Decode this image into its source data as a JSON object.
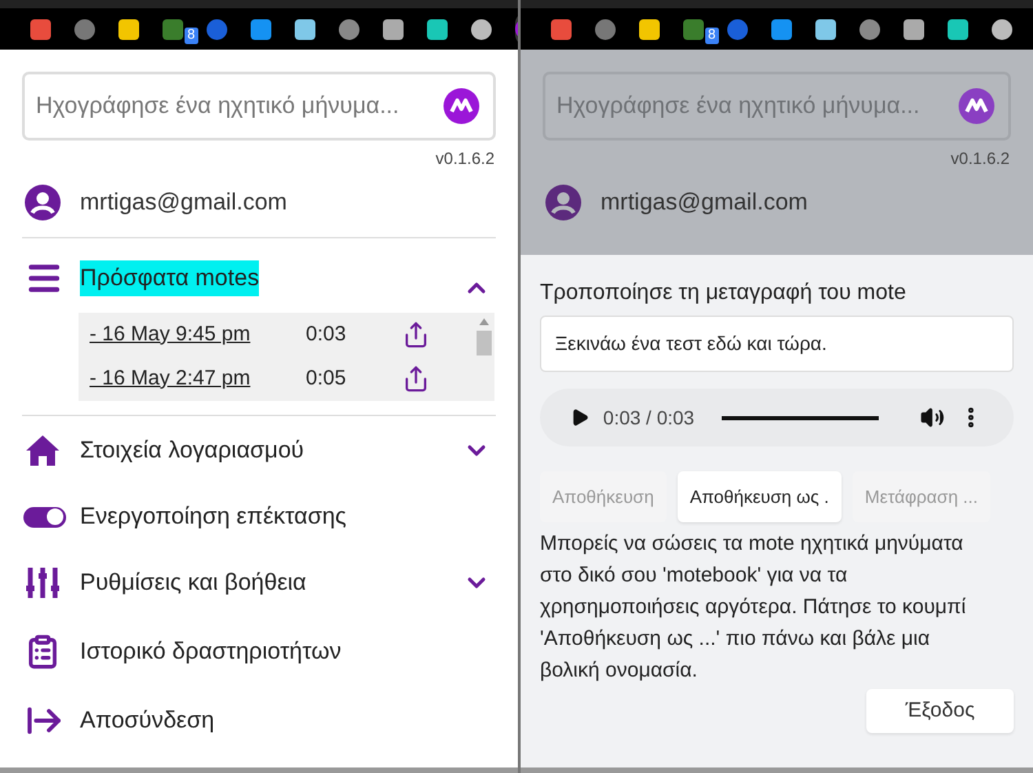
{
  "left_popup": {
    "dimmed": false,
    "toolbar": {
      "badge": "8"
    },
    "search": {
      "placeholder": "Ηχογράφησε ένα ηχητικό μήνυμα..."
    },
    "version": "v0.1.6.2",
    "account": {
      "email": "mrtigas@gmail.com"
    },
    "menu": [
      {
        "kind": "section",
        "label": "Πρόσφατα motes",
        "expanded": true,
        "highlighted": true,
        "recordings": [
          {
            "date": "- 16 May 9:45 pm",
            "duration": "0:03"
          },
          {
            "date": "- 16 May 2:47 pm",
            "duration": "0:05"
          }
        ]
      },
      {
        "kind": "section",
        "label": "Στοιχεία λογαριασμού",
        "expanded": false,
        "highlighted": false
      },
      {
        "kind": "toggle",
        "label": "Ενεργοποίηση επέκτασης",
        "on": true,
        "highlighted": false
      },
      {
        "kind": "section",
        "label": "Ρυθμίσεις και βοήθεια",
        "expanded": false,
        "highlighted": false
      },
      {
        "kind": "link",
        "label": "Ιστορικό δραστηριοτήτων",
        "highlighted": false
      },
      {
        "kind": "link",
        "label": "Αποσύνδεση",
        "highlighted": false
      }
    ]
  },
  "right_popup": {
    "dimmed": true,
    "toolbar": {
      "badge": "8"
    },
    "search": {
      "placeholder": "Ηχογράφησε ένα ηχητικό μήνυμα..."
    },
    "version": "v0.1.6.2",
    "account": {
      "email": "mrtigas@gmail.com"
    },
    "dialog": {
      "title": "Τροποποίησε τη μεταγραφή του mote",
      "transcript": "Ξεκινάω ένα τεστ εδώ και τώρα.",
      "player": {
        "time": "0:03 / 0:03",
        "level": 1
      },
      "buttons": [
        {
          "label": "Αποθήκευση",
          "disabled": true
        },
        {
          "label": "Αποθήκευση ως .",
          "disabled": false
        },
        {
          "label": "Μετάφραση ...",
          "disabled": true
        }
      ],
      "help": "Μπορείς να σώσεις τα mote ηχητικά μηνύματα στο δικό σου 'motebook' για να τα χρησημοποιήσεις αργότερα. Πάτησε το κουμπί 'Αποθήκευση ως ...' πιο πάνω και βάλε μια βολική ονομασία.",
      "exit": "Έξοδος"
    }
  }
}
